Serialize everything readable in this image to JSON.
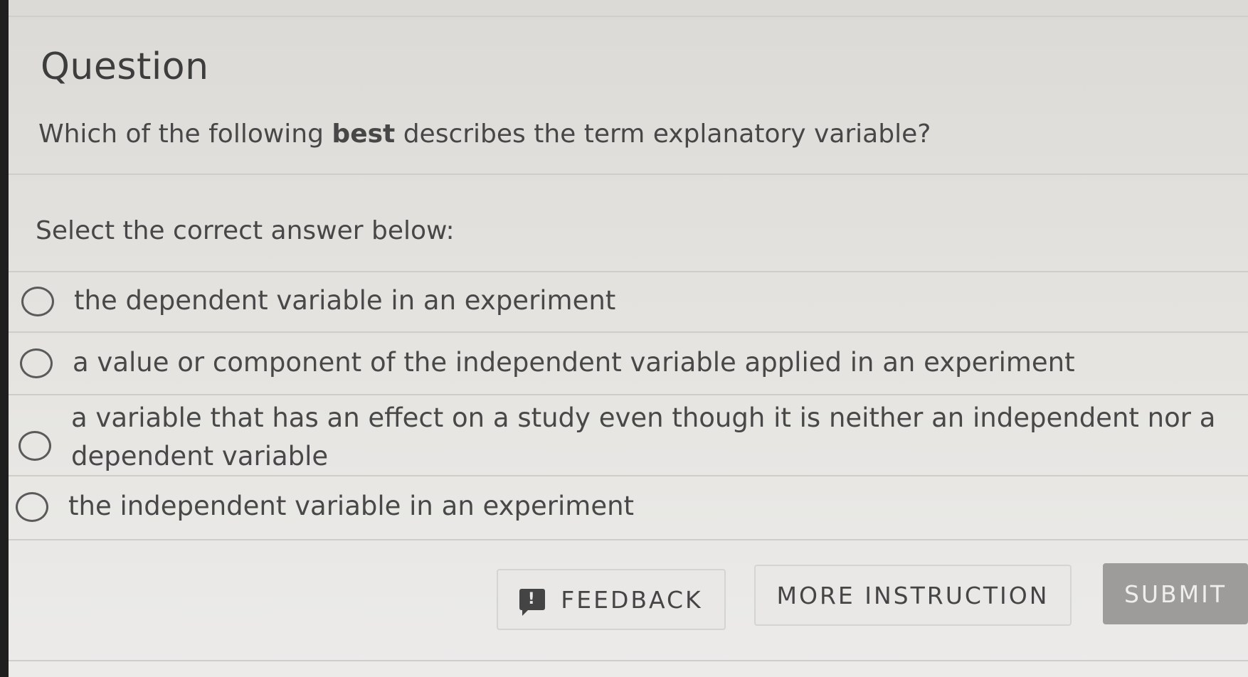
{
  "title": "Question",
  "question": {
    "prefix": "Which of the following ",
    "bold": "best",
    "suffix": " describes the term explanatory variable?"
  },
  "prompt": "Select the correct answer below:",
  "options": [
    {
      "label": "the dependent variable in an experiment"
    },
    {
      "label": "a value or component of the independent variable applied in an experiment"
    },
    {
      "label_line1": "a variable that has an effect on a study even though it is neither an independent nor a",
      "label_line2": "dependent variable"
    },
    {
      "label": "the independent variable in an experiment"
    }
  ],
  "buttons": {
    "feedback_icon": "!",
    "feedback": "FEEDBACK",
    "more_instruction": "MORE INSTRUCTION",
    "submit": "SUBMIT"
  },
  "icons": {
    "feedback": "feedback-icon",
    "radio": "radio-empty-icon"
  }
}
